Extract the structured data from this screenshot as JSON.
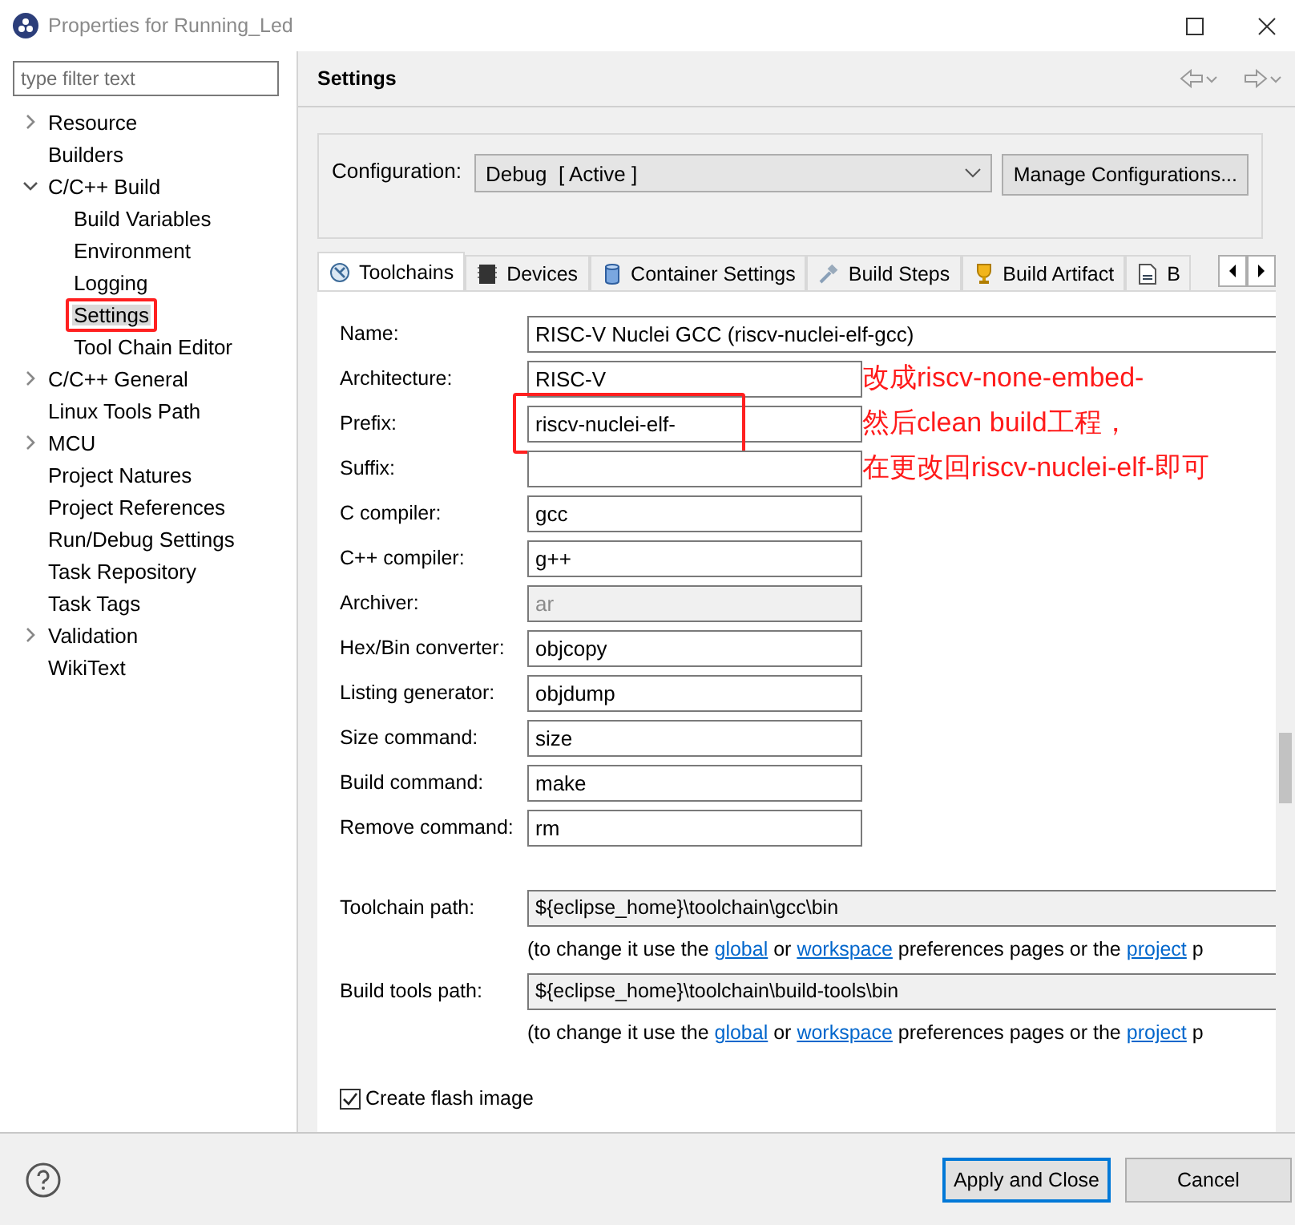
{
  "window": {
    "title": "Properties for Running_Led"
  },
  "filter": {
    "placeholder": "type filter text"
  },
  "tree": [
    {
      "label": "Resource",
      "expanded": false,
      "selected": false,
      "annotated": false
    },
    {
      "label": "Builders",
      "selected": false,
      "annotated": false
    },
    {
      "label": "C/C++ Build",
      "expanded": true,
      "selected": false,
      "annotated": false,
      "children": [
        {
          "label": "Build Variables",
          "selected": false,
          "annotated": false
        },
        {
          "label": "Environment",
          "selected": false,
          "annotated": false
        },
        {
          "label": "Logging",
          "selected": false,
          "annotated": false
        },
        {
          "label": "Settings",
          "selected": true,
          "annotated": true
        },
        {
          "label": "Tool Chain Editor",
          "selected": false,
          "annotated": false
        }
      ]
    },
    {
      "label": "C/C++ General",
      "expanded": false,
      "selected": false,
      "annotated": false
    },
    {
      "label": "Linux Tools Path",
      "selected": false,
      "annotated": false
    },
    {
      "label": "MCU",
      "expanded": false,
      "selected": false,
      "annotated": false
    },
    {
      "label": "Project Natures",
      "selected": false,
      "annotated": false
    },
    {
      "label": "Project References",
      "selected": false,
      "annotated": false
    },
    {
      "label": "Run/Debug Settings",
      "selected": false,
      "annotated": false
    },
    {
      "label": "Task Repository",
      "selected": false,
      "annotated": false
    },
    {
      "label": "Task Tags",
      "selected": false,
      "annotated": false
    },
    {
      "label": "Validation",
      "expanded": false,
      "selected": false,
      "annotated": false
    },
    {
      "label": "WikiText",
      "selected": false,
      "annotated": false
    }
  ],
  "page_title": "Settings",
  "configuration": {
    "label": "Configuration:",
    "value": "Debug  [ Active ]",
    "button": "Manage Configurations..."
  },
  "tabs": [
    {
      "label": "Toolchains",
      "selected": true
    },
    {
      "label": "Devices",
      "selected": false
    },
    {
      "label": "Container Settings",
      "selected": false
    },
    {
      "label": "Build Steps",
      "selected": false
    },
    {
      "label": "Build Artifact",
      "selected": false
    },
    {
      "label": "B",
      "selected": false
    }
  ],
  "fields": [
    {
      "label": "Name:",
      "value": "RISC-V Nuclei GCC (riscv-nuclei-elf-gcc)",
      "kind": "wide",
      "disabled": false,
      "annotated": false
    },
    {
      "label": "Architecture:",
      "value": "RISC-V",
      "kind": "short",
      "disabled": false,
      "annotated": false
    },
    {
      "label": "Prefix:",
      "value": "riscv-nuclei-elf-",
      "kind": "short",
      "disabled": false,
      "annotated": true
    },
    {
      "label": "Suffix:",
      "kind": "short",
      "disabled": false,
      "annotated": false
    },
    {
      "label": "C compiler:",
      "value": "gcc",
      "kind": "short",
      "disabled": false,
      "annotated": false
    },
    {
      "label": "C++ compiler:",
      "value": "g++",
      "kind": "short",
      "disabled": false,
      "annotated": false
    },
    {
      "label": "Archiver:",
      "value": "ar",
      "kind": "short",
      "disabled": true,
      "annotated": false
    },
    {
      "label": "Hex/Bin converter:",
      "value": "objcopy",
      "kind": "short",
      "disabled": false,
      "annotated": false
    },
    {
      "label": "Listing generator:",
      "value": "objdump",
      "kind": "short",
      "disabled": false,
      "annotated": false
    },
    {
      "label": "Size command:",
      "value": "size",
      "kind": "short",
      "disabled": false,
      "annotated": false
    },
    {
      "label": "Build command:",
      "value": "make",
      "kind": "short",
      "disabled": false,
      "annotated": false
    },
    {
      "label": "Remove command:",
      "value": "rm",
      "kind": "short",
      "disabled": false,
      "annotated": false
    }
  ],
  "paths": [
    {
      "label": "Toolchain path:",
      "value": "${eclipse_home}\\toolchain\\gcc\\bin",
      "note": [
        {
          "text": "(to change it use the ",
          "link": false
        },
        {
          "text": "global",
          "link": true
        },
        {
          "text": " or ",
          "link": false
        },
        {
          "text": "workspace",
          "link": true
        },
        {
          "text": " preferences pages or the ",
          "link": false
        },
        {
          "text": "project",
          "link": true
        },
        {
          "text": " p",
          "link": false
        }
      ]
    },
    {
      "label": "Build tools path:",
      "value": "${eclipse_home}\\toolchain\\build-tools\\bin",
      "note": [
        {
          "text": "(to change it use the ",
          "link": false
        },
        {
          "text": "global",
          "link": true
        },
        {
          "text": " or ",
          "link": false
        },
        {
          "text": "workspace",
          "link": true
        },
        {
          "text": " preferences pages or the ",
          "link": false
        },
        {
          "text": "project",
          "link": true
        },
        {
          "text": " p",
          "link": false
        }
      ]
    }
  ],
  "checkboxes": [
    {
      "label": "Create flash image",
      "checked": true
    }
  ],
  "annotation": [
    "改成riscv-none-embed-",
    "然后clean build工程，",
    "在更改回riscv-nuclei-elf-即可"
  ],
  "buttons": [
    {
      "label": "Apply and Close",
      "default": true
    },
    {
      "label": "Cancel",
      "default": false
    }
  ]
}
